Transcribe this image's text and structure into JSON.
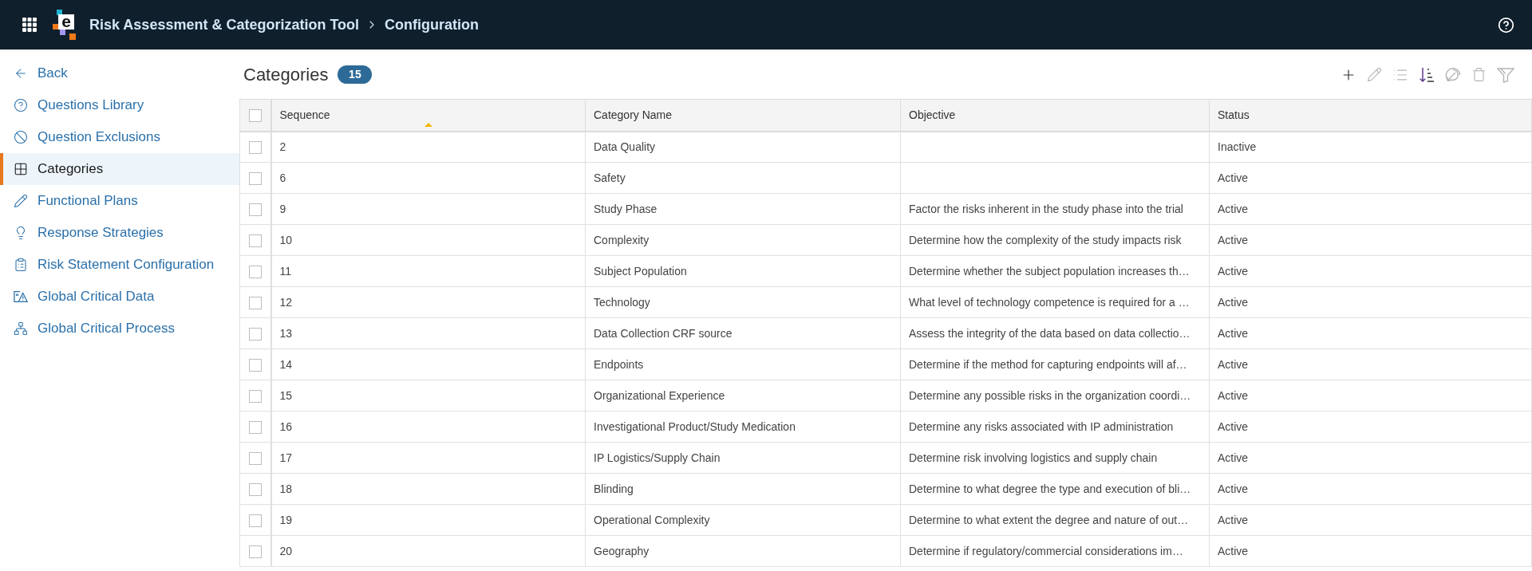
{
  "header": {
    "logo": "e",
    "app_title": "Risk Assessment & Categorization Tool",
    "page_title": "Configuration"
  },
  "sidebar": {
    "back": "Back",
    "items": [
      {
        "label": "Questions Library",
        "selected": false
      },
      {
        "label": "Question Exclusions",
        "selected": false
      },
      {
        "label": "Categories",
        "selected": true
      },
      {
        "label": "Functional Plans",
        "selected": false
      },
      {
        "label": "Response Strategies",
        "selected": false
      },
      {
        "label": "Risk Statement Configuration",
        "selected": false
      },
      {
        "label": "Global Critical Data",
        "selected": false
      },
      {
        "label": "Global Critical Process",
        "selected": false
      }
    ]
  },
  "main": {
    "title": "Categories",
    "count": "15",
    "toolbar": [
      {
        "disabled": false
      },
      {
        "disabled": true
      },
      {
        "disabled": true
      },
      {
        "disabled": false
      },
      {
        "disabled": true
      },
      {
        "disabled": true
      },
      {
        "disabled": true
      }
    ]
  },
  "table": {
    "select_all": {
      "checked": false
    },
    "columns": [
      {
        "label": "Sequence",
        "sorted": true
      },
      {
        "label": "Category Name",
        "sorted": false
      },
      {
        "label": "Objective",
        "sorted": false
      },
      {
        "label": "Status",
        "sorted": false
      }
    ],
    "rows": [
      {
        "selected": false,
        "sequence": "2",
        "name": "Data Quality",
        "status": "Inactive"
      },
      {
        "selected": false,
        "sequence": "6",
        "name": "Safety",
        "status": "Active"
      },
      {
        "selected": false,
        "sequence": "9",
        "name": "Study Phase",
        "objective": "Factor the risks inherent in the study phase into the trial",
        "status": "Active"
      },
      {
        "selected": false,
        "sequence": "10",
        "name": "Complexity",
        "objective": "Determine how the complexity of the study impacts risk",
        "status": "Active"
      },
      {
        "selected": false,
        "sequence": "11",
        "name": "Subject Population",
        "objective": "Determine whether the subject population increases th…",
        "status": "Active"
      },
      {
        "selected": false,
        "sequence": "12",
        "name": "Technology",
        "objective": "What level of technology competence is required for a …",
        "status": "Active"
      },
      {
        "selected": false,
        "sequence": "13",
        "name": "Data Collection CRF source",
        "objective": "Assess the integrity of the data based on data collectio…",
        "status": "Active"
      },
      {
        "selected": false,
        "sequence": "14",
        "name": "Endpoints",
        "objective": "Determine if the method for capturing endpoints will af…",
        "status": "Active"
      },
      {
        "selected": false,
        "sequence": "15",
        "name": "Organizational Experience",
        "objective": "Determine any possible risks in the organization coordi…",
        "status": "Active"
      },
      {
        "selected": false,
        "sequence": "16",
        "name": "Investigational Product/Study Medication",
        "objective": "Determine any risks associated with IP administration",
        "status": "Active"
      },
      {
        "selected": false,
        "sequence": "17",
        "name": "IP Logistics/Supply Chain",
        "objective": "Determine risk involving logistics and supply chain",
        "status": "Active"
      },
      {
        "selected": false,
        "sequence": "18",
        "name": "Blinding",
        "objective": "Determine to what degree the type and execution of bli…",
        "status": "Active"
      },
      {
        "selected": false,
        "sequence": "19",
        "name": "Operational Complexity",
        "objective": "Determine to what extent the degree and nature of out…",
        "status": "Active"
      },
      {
        "selected": false,
        "sequence": "20",
        "name": "Geography",
        "objective": "Determine if regulatory/commercial considerations im…",
        "status": "Active"
      }
    ]
  }
}
